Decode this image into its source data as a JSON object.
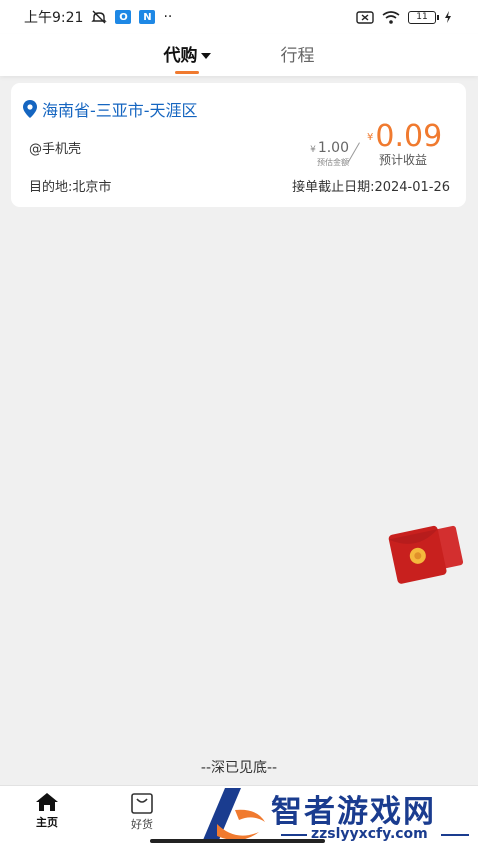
{
  "status_bar": {
    "time": "上午9:21",
    "app_icon_1": "O",
    "app_icon_2": "N",
    "more": "··",
    "battery": "11"
  },
  "tabs": [
    {
      "label": "代购",
      "active": true
    },
    {
      "label": "行程",
      "active": false
    }
  ],
  "order": {
    "location": "海南省-三亚市-天涯区",
    "item": "@手机壳",
    "destination": "目的地:北京市",
    "deadline": "接单截止日期:2024-01-26",
    "estimated_amount": {
      "currency": "¥",
      "value": "1.00",
      "label": "预估金额"
    },
    "estimated_income": {
      "currency": "¥",
      "value": "0.09",
      "label": "预计收益"
    }
  },
  "end_of_list": "--深已见底--",
  "bottom_nav": [
    {
      "label": "主页",
      "icon": "home-icon"
    },
    {
      "label": "好货",
      "icon": "bag-icon"
    }
  ],
  "watermark": {
    "title": "智者游戏网",
    "url": "zzslyyxcfy.com"
  },
  "colors": {
    "accent": "#f07a2f",
    "location": "#1565c0",
    "envelope": "#c8201e"
  }
}
